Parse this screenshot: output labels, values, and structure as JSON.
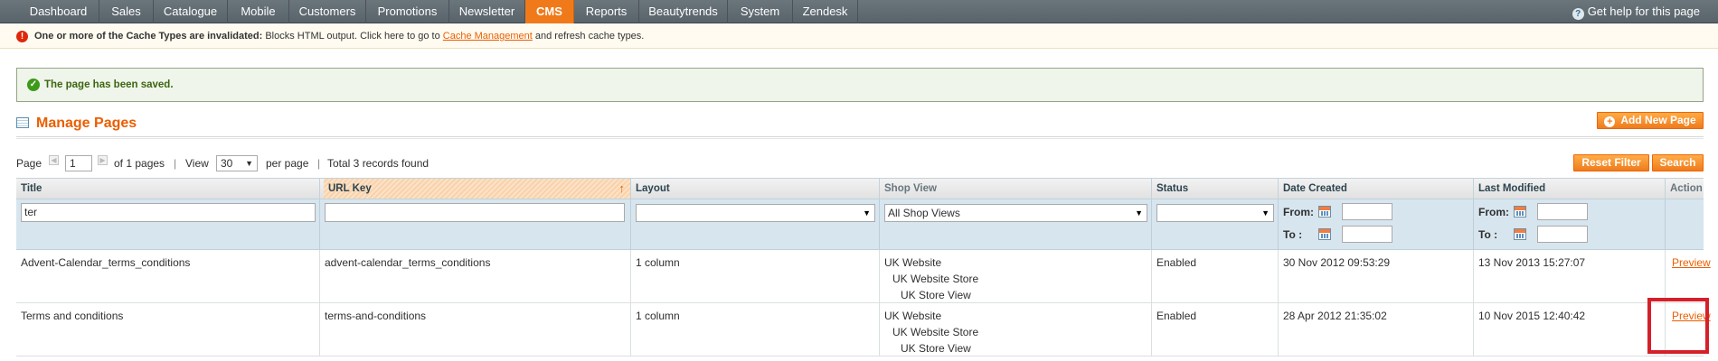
{
  "nav": {
    "items": [
      "Dashboard",
      "Sales",
      "Catalogue",
      "Mobile",
      "Customers",
      "Promotions",
      "Newsletter",
      "CMS",
      "Reports",
      "Beautytrends",
      "System",
      "Zendesk"
    ],
    "active": "CMS",
    "help_text": "Get help for this page"
  },
  "notice": {
    "bold": "One or more of the Cache Types are invalidated:",
    "text_before": " Blocks HTML output. Click here to go to ",
    "link": "Cache Management",
    "text_after": " and refresh cache types."
  },
  "success": {
    "message": "The page has been saved."
  },
  "heading": {
    "title": "Manage Pages",
    "add_button": "Add New Page"
  },
  "pager": {
    "page_label": "Page",
    "page_value": "1",
    "of_pages": "of 1 pages",
    "view_label": "View",
    "per_page_value": "30",
    "per_page_label": "per page",
    "total": "Total 3 records found",
    "separator": "|"
  },
  "buttons": {
    "reset": "Reset Filter",
    "search": "Search"
  },
  "grid": {
    "columns": [
      "Title",
      "URL Key",
      "Layout",
      "Shop View",
      "Status",
      "Date Created",
      "Last Modified",
      "Action"
    ],
    "filters": {
      "title": "ter",
      "url_key": "",
      "layout": "",
      "shop_view": "All Shop Views",
      "status": "",
      "from_label": "From:",
      "to_label": "To :"
    },
    "rows": [
      {
        "title": "Advent-Calendar_terms_conditions",
        "url_key": "advent-calendar_terms_conditions",
        "layout": "1 column",
        "shop_view": [
          "UK Website",
          "UK Website Store",
          "UK Store View"
        ],
        "status": "Enabled",
        "created": "30 Nov 2012 09:53:29",
        "modified": "13 Nov 2013 15:27:07",
        "action": "Preview"
      },
      {
        "title": "Terms and conditions",
        "url_key": "terms-and-conditions",
        "layout": "1 column",
        "shop_view": [
          "UK Website",
          "UK Website Store",
          "UK Store View"
        ],
        "status": "Enabled",
        "created": "28 Apr 2012 21:35:02",
        "modified": "10 Nov 2015 12:40:42",
        "action": "Preview"
      }
    ]
  },
  "colors": {
    "accent": "#eb5e00",
    "nav_bg": "#5f6a71",
    "highlight_box": "#d5202a"
  }
}
